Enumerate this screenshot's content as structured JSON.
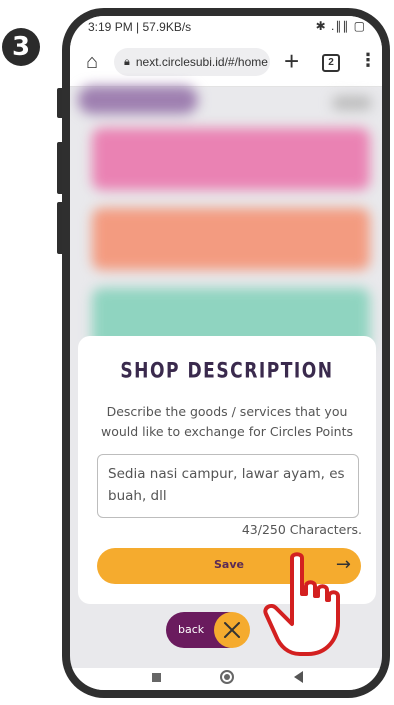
{
  "step_number": "3",
  "statusbar": {
    "time_speed": "3:19 PM | 57.9KB/s",
    "icons": "✱ .∥∥ ▢"
  },
  "browser": {
    "url": "next.circlesubi.id/#/home",
    "tab_count": "2",
    "icons": {
      "home": "home-icon",
      "lock": "lock-icon",
      "new_tab": "plus-icon",
      "tabs": "tabs-icon",
      "menu": "more-vert-icon"
    }
  },
  "modal": {
    "title": "SHOP DESCRIPTION",
    "description": "Describe the goods / services that you would like to exchange for Circles Points",
    "field_value": "Sedia nasi campur, lawar ayam, es buah, dll",
    "char_count": "43/250 Characters.",
    "save_label": "Save"
  },
  "back_toggle": {
    "label": "back"
  },
  "colors": {
    "accent": "#f5ab2e",
    "purple": "#6a1b5e",
    "card_pink": "#ea82b3",
    "card_orange": "#f39b80",
    "card_green": "#8fd4c0"
  }
}
